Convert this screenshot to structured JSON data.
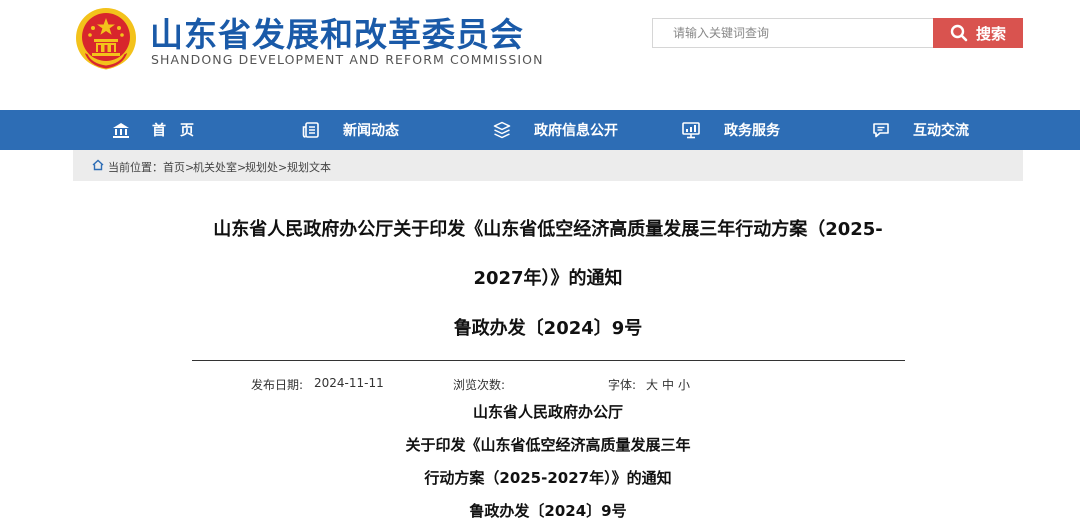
{
  "header": {
    "site_title": "山东省发展和改革委员会",
    "site_subtitle": "SHANDONG DEVELOPMENT AND REFORM COMMISSION",
    "emblem_icon": "national-emblem-icon",
    "search": {
      "placeholder": "请输入关键词查询",
      "value": "",
      "button_label": "搜索",
      "button_icon": "search-icon"
    }
  },
  "nav": {
    "items": [
      {
        "label": "首　页",
        "icon": "home-icon"
      },
      {
        "label": "新闻动态",
        "icon": "news-icon"
      },
      {
        "label": "政府信息公开",
        "icon": "layers-icon"
      },
      {
        "label": "政务服务",
        "icon": "monitor-icon"
      },
      {
        "label": "互动交流",
        "icon": "chat-icon"
      }
    ]
  },
  "breadcrumb": {
    "prefix": "当前位置：",
    "items": [
      "首页>",
      "机关处室>",
      "规划处>",
      "规划文本"
    ]
  },
  "article": {
    "title_line1": "山东省人民政府办公厅关于印发《山东省低空经济高质量发展三年行动方案（2025-",
    "title_line2": "2027年）》的通知",
    "doc_number": "鲁政办发〔2024〕9号",
    "meta": {
      "date_label": "发布日期:",
      "date_value": "2024-11-11",
      "views_label": "浏览次数:",
      "font_label": "字体:",
      "size_large": "大",
      "size_medium": "中",
      "size_small": "小"
    },
    "body": [
      "山东省人民政府办公厅",
      "关于印发《山东省低空经济高质量发展三年",
      "行动方案（2025-2027年）》的通知",
      "鲁政办发〔2024〕9号"
    ]
  },
  "colors": {
    "brand_blue": "#1a5aa8",
    "nav_blue": "#2d6db5",
    "search_red": "#d9534f",
    "emblem_red": "#d8262c",
    "emblem_gold": "#f3c21b"
  }
}
